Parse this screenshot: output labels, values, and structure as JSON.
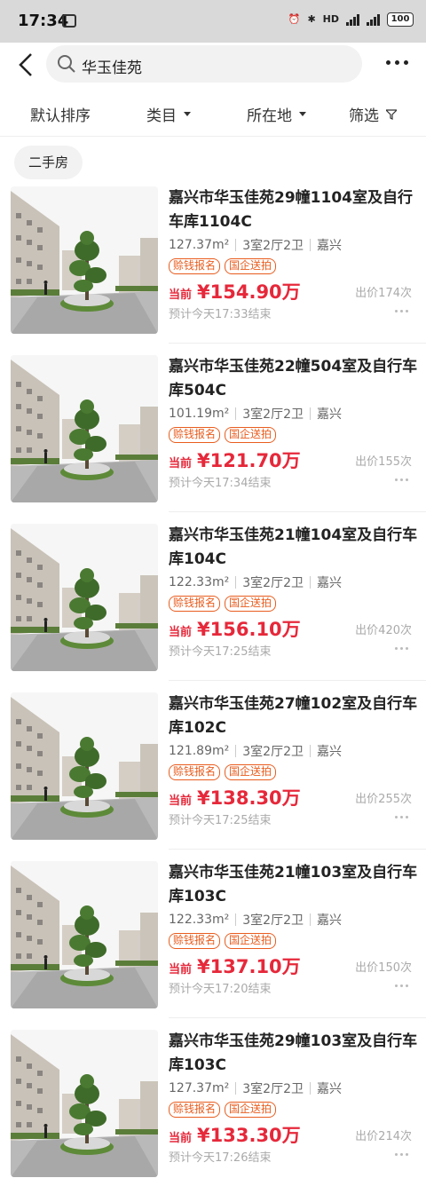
{
  "status": {
    "time": "17:34",
    "battery": "100"
  },
  "search": {
    "query": "华玉佳苑"
  },
  "filters": [
    {
      "label": "默认排序",
      "has_caret": false
    },
    {
      "label": "类目",
      "has_caret": true
    },
    {
      "label": "所在地",
      "has_caret": true
    },
    {
      "label": "筛选",
      "has_funnel": true
    }
  ],
  "chip": {
    "label": "二手房"
  },
  "labels": {
    "current": "当前"
  },
  "listings": [
    {
      "title": "嘉兴市华玉佳苑29幢1104室及自行车库1104C",
      "area": "127.37m²",
      "layout": "3室2厅2卫",
      "city": "嘉兴",
      "tags": [
        "赊钱报名",
        "国企送拍"
      ],
      "price": "¥154.90万",
      "bids": "出价174次",
      "end": "预计今天17:33结束"
    },
    {
      "title": "嘉兴市华玉佳苑22幢504室及自行车库504C",
      "area": "101.19m²",
      "layout": "3室2厅2卫",
      "city": "嘉兴",
      "tags": [
        "赊钱报名",
        "国企送拍"
      ],
      "price": "¥121.70万",
      "bids": "出价155次",
      "end": "预计今天17:34结束"
    },
    {
      "title": "嘉兴市华玉佳苑21幢104室及自行车库104C",
      "area": "122.33m²",
      "layout": "3室2厅2卫",
      "city": "嘉兴",
      "tags": [
        "赊钱报名",
        "国企送拍"
      ],
      "price": "¥156.10万",
      "bids": "出价420次",
      "end": "预计今天17:25结束"
    },
    {
      "title": "嘉兴市华玉佳苑27幢102室及自行车库102C",
      "area": "121.89m²",
      "layout": "3室2厅2卫",
      "city": "嘉兴",
      "tags": [
        "赊钱报名",
        "国企送拍"
      ],
      "price": "¥138.30万",
      "bids": "出价255次",
      "end": "预计今天17:25结束"
    },
    {
      "title": "嘉兴市华玉佳苑21幢103室及自行车库103C",
      "area": "122.33m²",
      "layout": "3室2厅2卫",
      "city": "嘉兴",
      "tags": [
        "赊钱报名",
        "国企送拍"
      ],
      "price": "¥137.10万",
      "bids": "出价150次",
      "end": "预计今天17:20结束"
    },
    {
      "title": "嘉兴市华玉佳苑29幢103室及自行车库103C",
      "area": "127.37m²",
      "layout": "3室2厅2卫",
      "city": "嘉兴",
      "tags": [
        "赊钱报名",
        "国企送拍"
      ],
      "price": "¥133.30万",
      "bids": "出价214次",
      "end": "预计今天17:26结束"
    }
  ]
}
